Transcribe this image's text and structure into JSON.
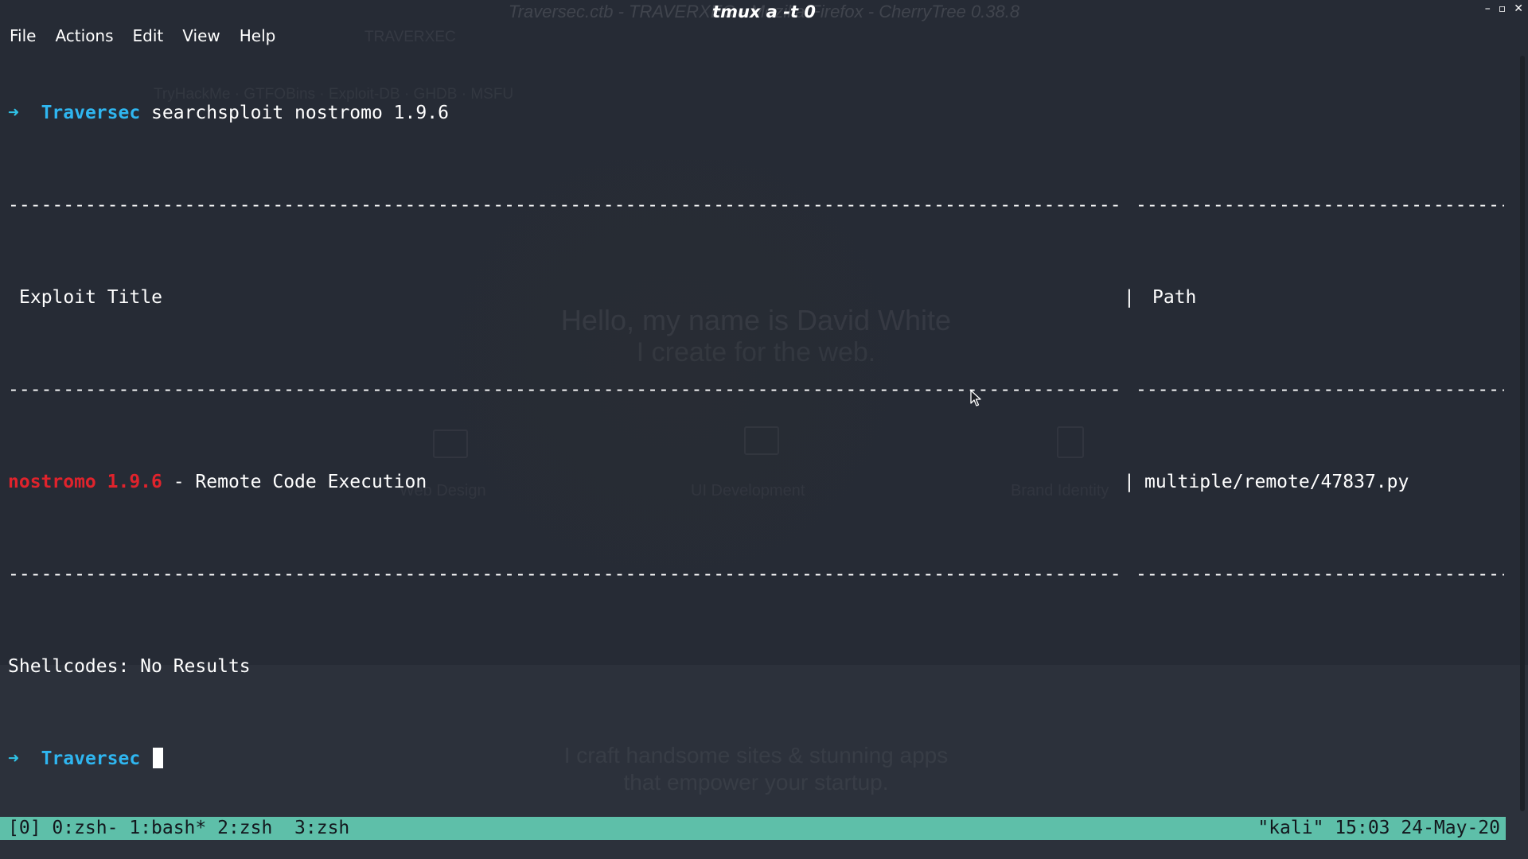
{
  "window": {
    "title": "tmux a -t 0",
    "controls": {
      "minimize": "–",
      "maximize": "▫",
      "close": "✕"
    }
  },
  "menu": {
    "items": [
      "File",
      "Actions",
      "Edit",
      "View",
      "Help"
    ]
  },
  "terminal": {
    "prompt_arrow": "➜",
    "prompt_dir": "Traversec",
    "command": "searchsploit nostromo 1.9.6",
    "separator_left": "--------------------------------------------------------------------------------------------------------------------------------------------------------------------------------------",
    "separator_right": "----------------------------------------------------------------",
    "header": {
      "title": "Exploit Title",
      "pipe": "|",
      "path": "Path"
    },
    "result": {
      "highlight": "nostromo 1.9.6",
      "title_rest": " - Remote Code Execution",
      "pipe": "|",
      "path": "multiple/remote/47837.py"
    },
    "shellcodes": "Shellcodes: No Results"
  },
  "tmux": {
    "left": "[0] 0:zsh- 1:bash* 2:zsh  3:zsh",
    "right": "\"kali\" 15:03 24-May-20",
    "color": "#5ebfa9"
  },
  "background": {
    "browser_title": "Traversec.ctb - TRAVERXEC - Mozilla Firefox - CherryTree 0.38.8",
    "tab": "TRAVERXEC",
    "bookmarks": "TryHackMe · GTFOBins · Exploit-DB · GHDB · MSFU",
    "hero_line1": "Hello, my name is David White",
    "hero_line2": "I create for the web.",
    "features": [
      "Web Design",
      "UI Development",
      "Brand Identity"
    ],
    "sub_line1": "I craft handsome sites & stunning apps",
    "sub_line2": "that empower your startup."
  },
  "colors": {
    "background": "#262b35",
    "prompt": "#2fb6f0",
    "highlight": "#e0232c",
    "text": "#ffffff"
  }
}
